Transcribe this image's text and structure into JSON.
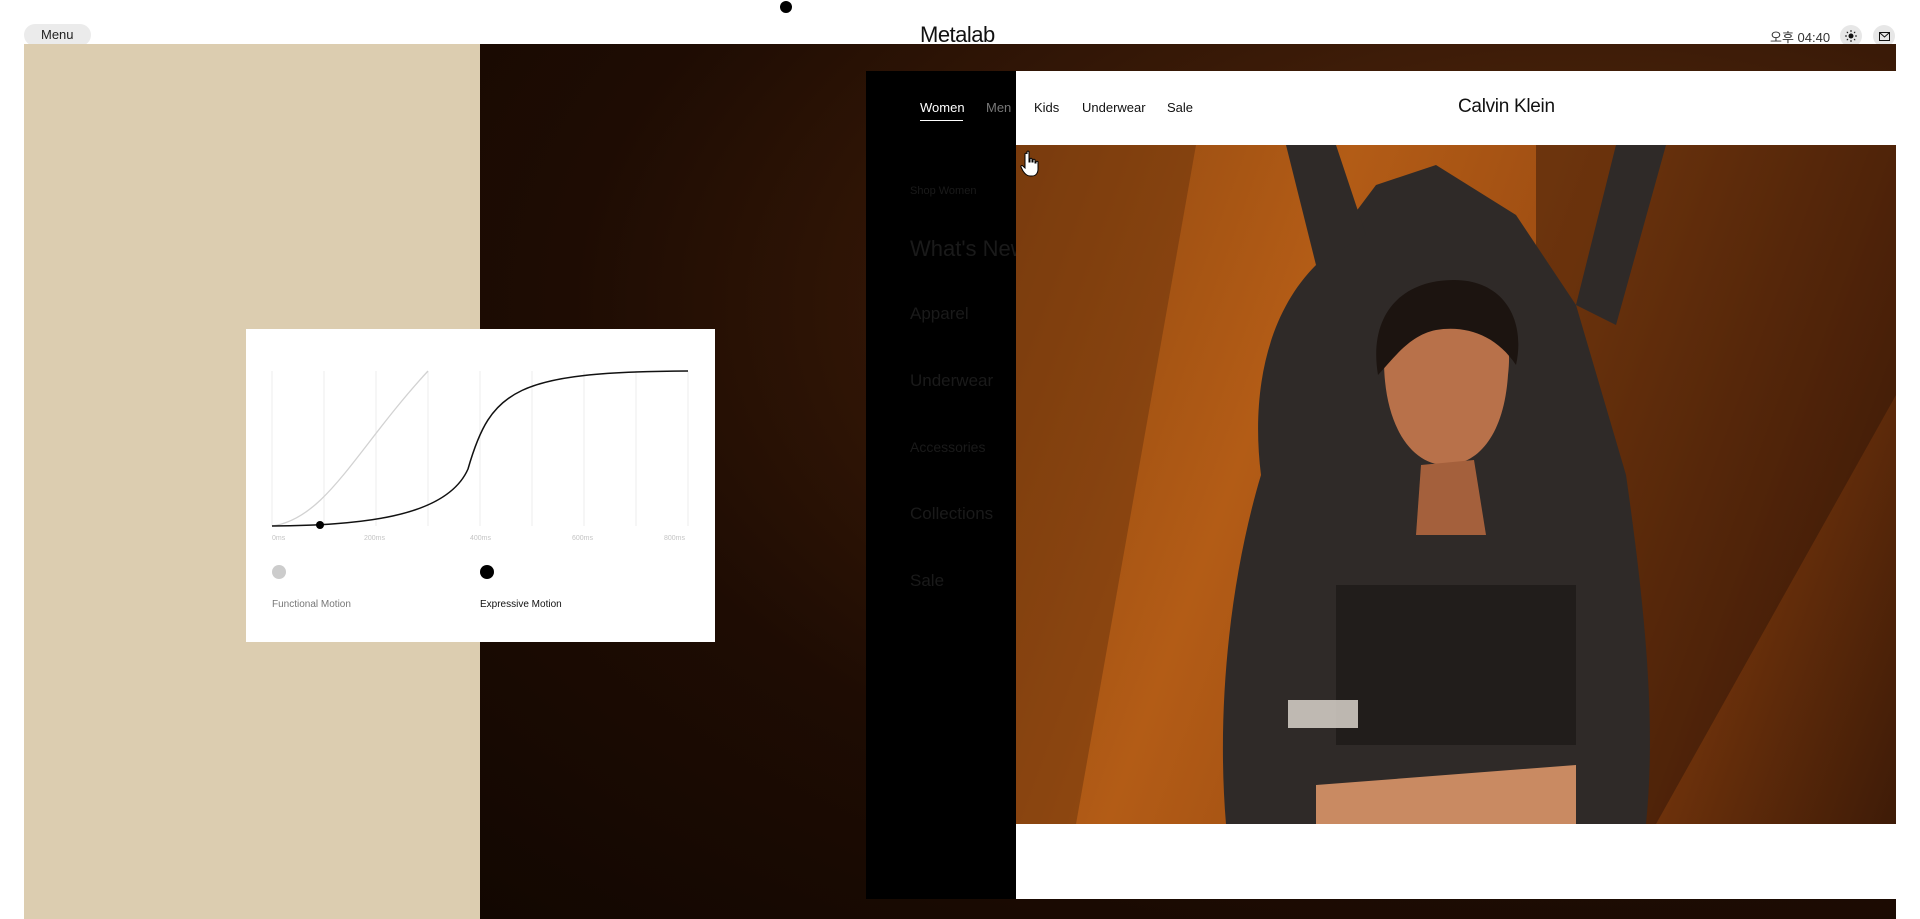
{
  "topbar": {
    "menu_label": "Menu",
    "brand": "Metalab",
    "clock": "오후 04:40",
    "icons": [
      "sun-icon",
      "mail-icon"
    ]
  },
  "motion_card": {
    "x_ticks": [
      "0ms",
      "200ms",
      "400ms",
      "600ms",
      "800ms"
    ],
    "legend": [
      {
        "label": "Functional Motion",
        "color": "#cccccc"
      },
      {
        "label": "Expressive Motion",
        "color": "#000000"
      }
    ]
  },
  "site": {
    "nav": {
      "women": "Women",
      "men": "Men",
      "kids": "Kids",
      "underwear": "Underwear",
      "sale": "Sale"
    },
    "logo": "Calvin Klein",
    "ghost_menu": [
      "Shop Women",
      "What's New",
      "Apparel",
      "Underwear",
      "Accessories",
      "Collections",
      "Sale"
    ]
  },
  "colors": {
    "beige": "#dccdb0",
    "dark_bg": "#1e0c03",
    "accent_black": "#000000"
  }
}
